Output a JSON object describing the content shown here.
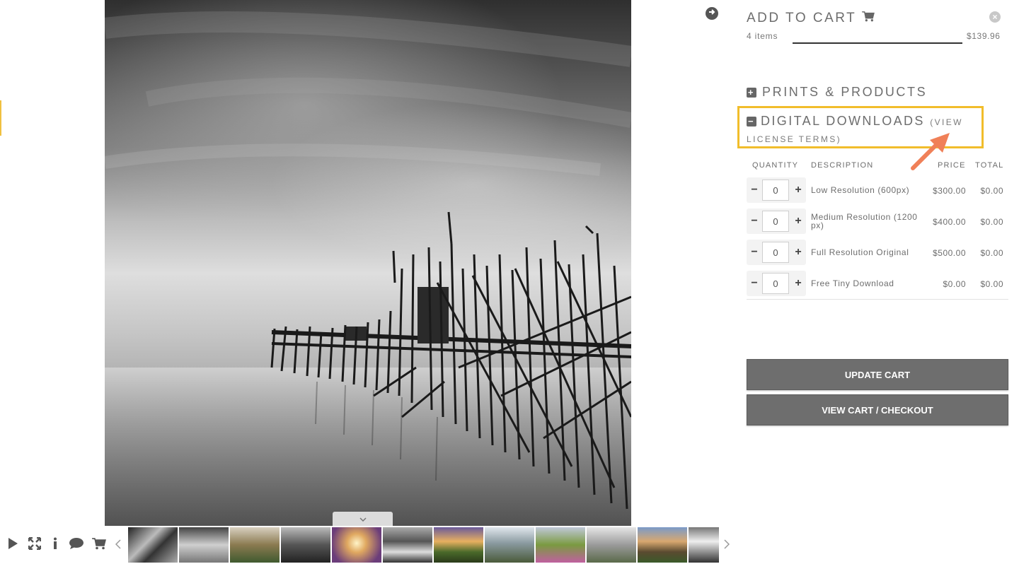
{
  "cart": {
    "title": "ADD TO CART",
    "items": "4 items",
    "total": "$139.96"
  },
  "sections": {
    "prints": "PRINTS & PRODUCTS",
    "downloads": "DIGITAL DOWNLOADS",
    "license": "(VIEW LICENSE TERMS)"
  },
  "table": {
    "headers": {
      "quantity": "QUANTITY",
      "description": "DESCRIPTION",
      "price": "PRICE",
      "total": "TOTAL"
    },
    "rows": [
      {
        "qty": "0",
        "description": "Low Resolution (600px)",
        "price": "$300.00",
        "total": "$0.00"
      },
      {
        "qty": "0",
        "description": "Medium Resolution (1200px)",
        "price": "$400.00",
        "total": "$0.00"
      },
      {
        "qty": "0",
        "description": "Full Resolution Original",
        "price": "$500.00",
        "total": "$0.00"
      },
      {
        "qty": "0",
        "description": "Free Tiny Download",
        "price": "$0.00",
        "total": "$0.00"
      }
    ]
  },
  "buttons": {
    "update": "UPDATE CART",
    "checkout": "VIEW CART / CHECKOUT"
  },
  "colors": {
    "highlight": "#f1bd2b",
    "arrow": "#f08058",
    "button": "#6e6e6e"
  },
  "icons": [
    "next-arrow-icon",
    "close-icon",
    "cart-icon",
    "plus-square-icon",
    "minus-square-icon",
    "play-icon",
    "fullscreen-icon",
    "info-icon",
    "comment-icon",
    "cart-icon",
    "chevron-left-icon",
    "chevron-right-icon",
    "chevron-down-icon"
  ]
}
